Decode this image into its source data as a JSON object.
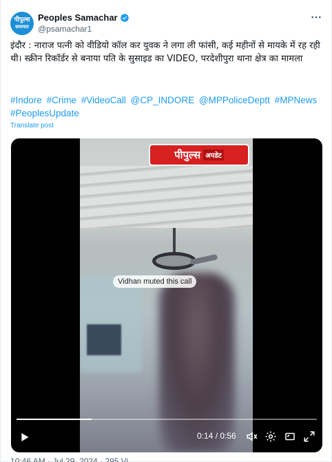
{
  "account": {
    "display_name": "Peoples Samachar",
    "handle": "@psamachar1",
    "avatar_text_top": "पीपुल्स",
    "avatar_text_bottom": "समाचार"
  },
  "post": {
    "text": "इंदौर : नाराज पत्नी को वीडियो कॉल कर युवक ने लगा ली फांसी, कई महीनों से मायके में रह रही थी। स्क्रीन रिकॉर्डर से बनाया पति के सुसाइड का VIDEO, परदेशीपुरा थाना क्षेत्र का मामला",
    "hashtags": [
      "#Indore",
      "#Crime",
      "#VideoCall",
      "@CP_INDORE",
      "@MPPoliceDeptt",
      "#MPNews",
      "#PeoplesUpdate"
    ],
    "translate_label": "Translate post",
    "footer_partial": "10:46 AM · Jul 29, 2024 · 295 Vi"
  },
  "video": {
    "brand_main": "पीपुल्स",
    "brand_sub": "अपडेट",
    "caption": "Vidhan muted this call",
    "current_time": "0:14",
    "duration": "0:56",
    "time_display": "0:14 / 0:56",
    "progress_fraction": 0.25
  },
  "icons": {
    "more": "more-horizontal-icon",
    "verified": "verified-badge-icon",
    "play": "play-icon",
    "volume": "volume-icon",
    "settings": "settings-gear-icon",
    "fullscreen": "fullscreen-icon",
    "expand": "expand-icon"
  },
  "colors": {
    "link": "#1d9bf0",
    "brand_red": "#d72020",
    "avatar_blue": "#1d8fd6"
  }
}
